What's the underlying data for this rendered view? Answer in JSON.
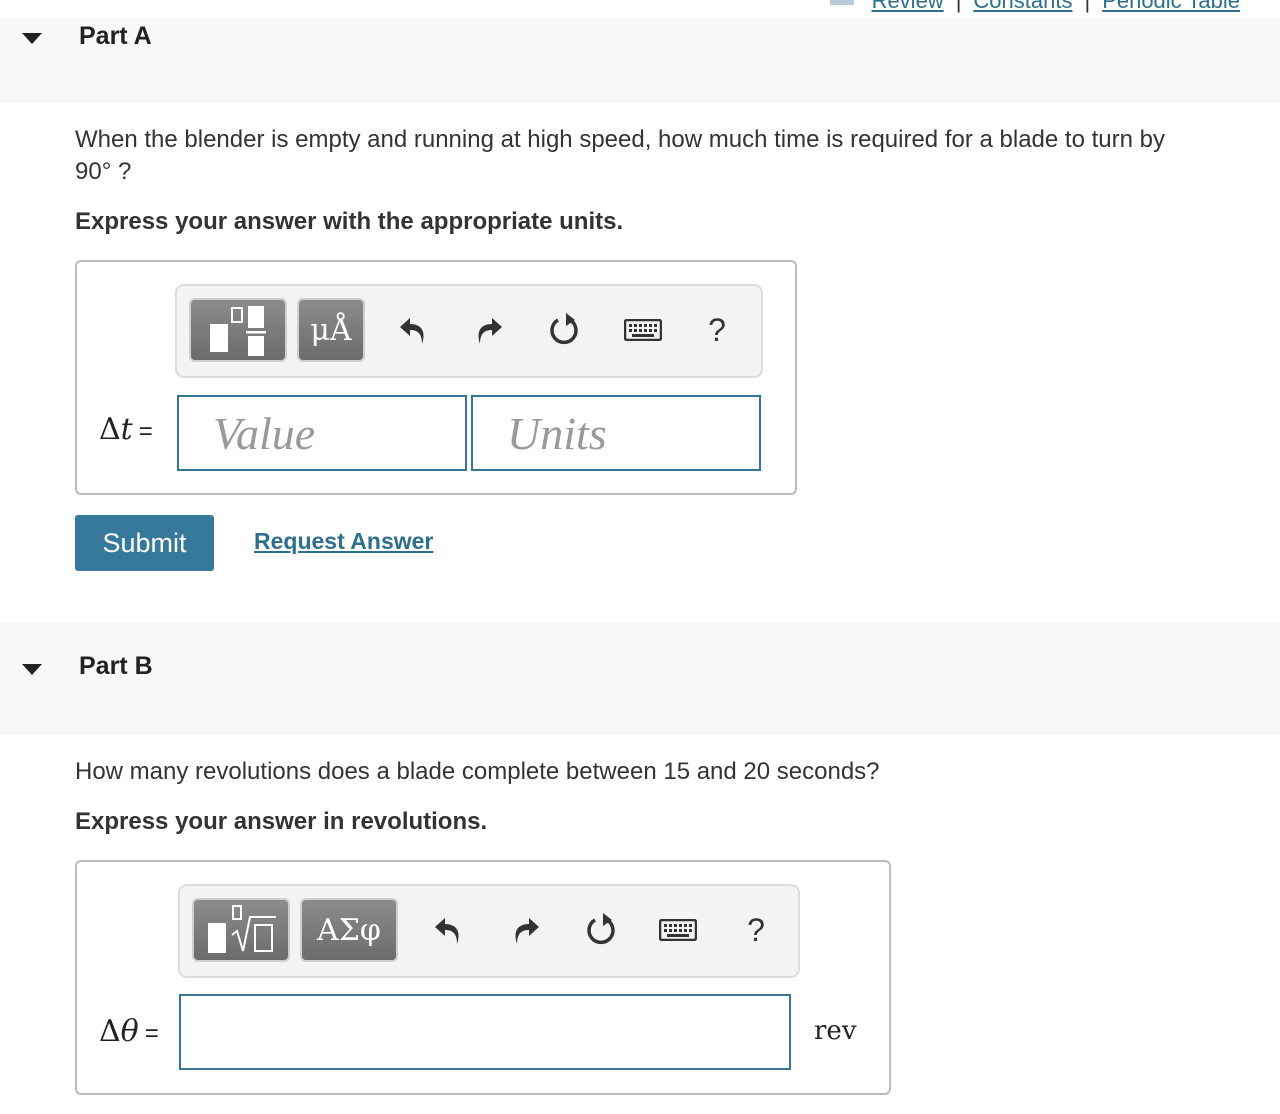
{
  "top_links": {
    "review": "Review",
    "separator": "|",
    "constants": "Constants",
    "periodic_table": "Periodic Table"
  },
  "part_a": {
    "title": "Part A",
    "question_line1": "When the blender is empty and running at high speed, how much time is required for a blade to turn by",
    "question_line2": "90° ?",
    "instruction": "Express your answer with the appropriate units.",
    "toolbar": {
      "template_button_icon": "fraction-template-icon",
      "units_button_label": "μÅ",
      "undo_icon": "undo-icon",
      "redo_icon": "redo-icon",
      "reset_icon": "reset-icon",
      "keyboard_icon": "keyboard-icon",
      "help_label": "?"
    },
    "variable_symbol": "Δ",
    "variable_name": "t",
    "equals": "=",
    "value_placeholder": "Value",
    "value": "",
    "units_placeholder": "Units",
    "units": "",
    "submit_label": "Submit",
    "request_answer_label": "Request Answer"
  },
  "part_b": {
    "title": "Part B",
    "question": "How many revolutions does a blade complete between 15 and 20 seconds?",
    "instruction": "Express your answer in revolutions.",
    "toolbar": {
      "template_button_icon": "radical-template-icon",
      "symbols_button_label": "ΑΣφ",
      "undo_icon": "undo-icon",
      "redo_icon": "redo-icon",
      "reset_icon": "reset-icon",
      "keyboard_icon": "keyboard-icon",
      "help_label": "?"
    },
    "variable_symbol": "Δ",
    "variable_name": "θ",
    "equals": "=",
    "answer_value": "",
    "unit": "rev"
  },
  "colors": {
    "accent": "#36799a",
    "link": "#2e6f8e",
    "header_bg": "#f8f8f8",
    "field_border": "#377796"
  }
}
